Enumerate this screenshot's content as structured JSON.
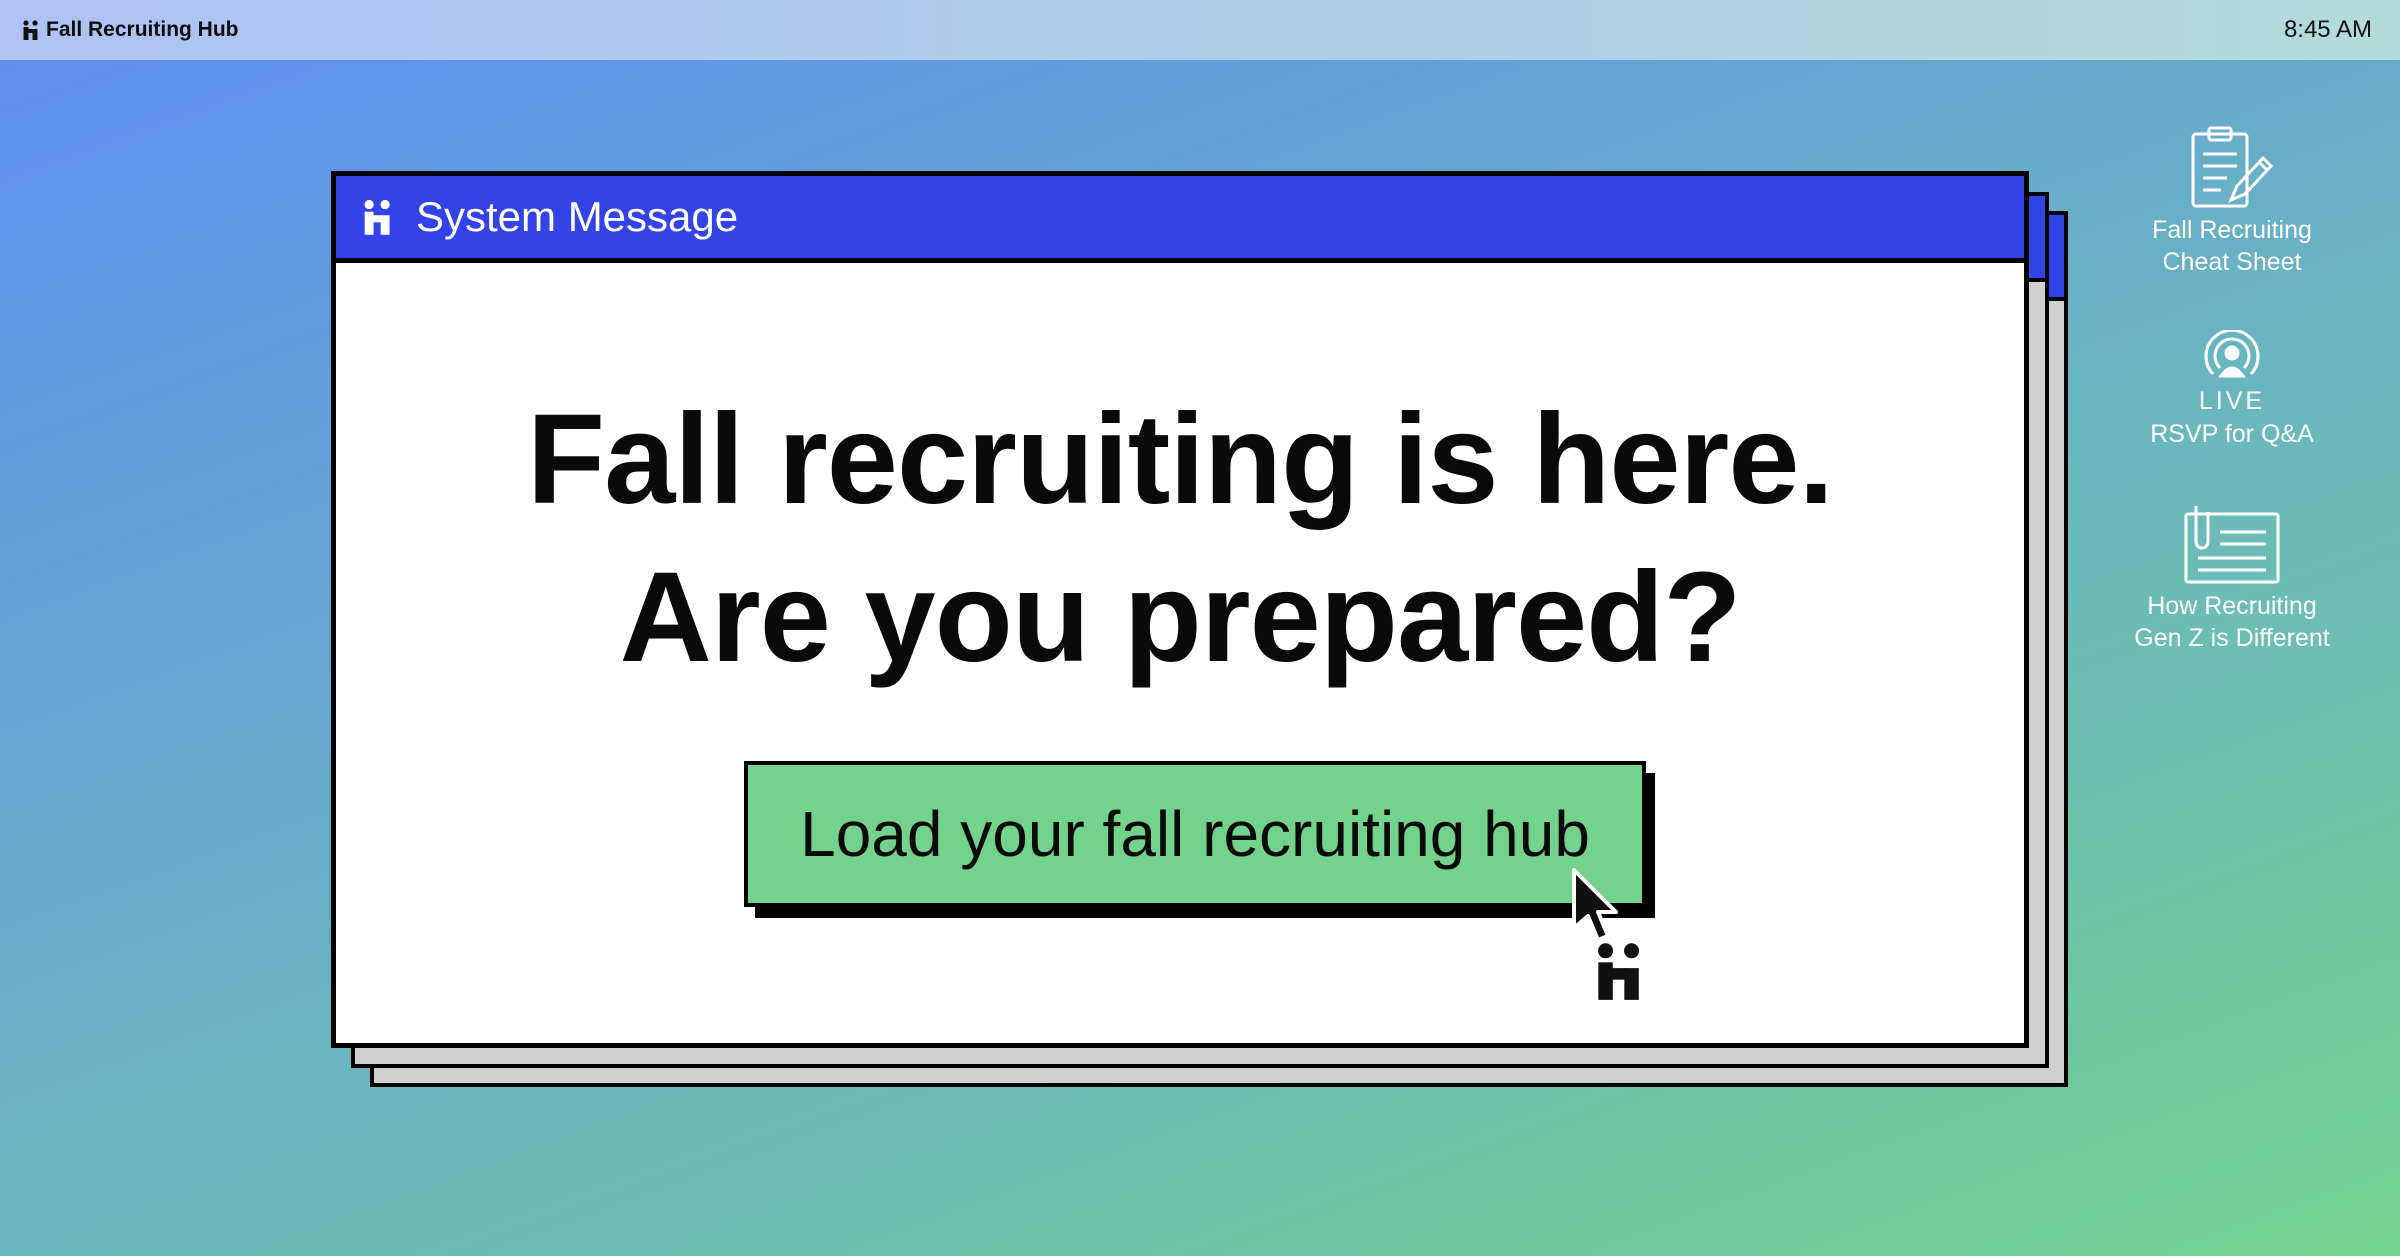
{
  "menubar": {
    "app_title": "Fall Recruiting Hub",
    "clock": "8:45 AM",
    "logo_icon": "handshake-hi-logo-icon"
  },
  "window": {
    "title": "System Message",
    "headline_line1": "Fall recruiting is here.",
    "headline_line2": "Are you prepared?",
    "cta_label": "Load your fall recruiting hub"
  },
  "desktop_icons": [
    {
      "icon": "clipboard-pencil-icon",
      "line1": "Fall Recruiting",
      "line2": "Cheat Sheet"
    },
    {
      "icon": "live-broadcast-icon",
      "badge": "LIVE",
      "line1": "RSVP for Q&A"
    },
    {
      "icon": "document-clip-icon",
      "line1": "How Recruiting",
      "line2": "Gen Z is Different"
    }
  ],
  "colors": {
    "titlebar_blue": "#3343e8",
    "cta_green": "#73d38c",
    "background_start": "#5f8ff2",
    "background_end": "#72d28f"
  }
}
